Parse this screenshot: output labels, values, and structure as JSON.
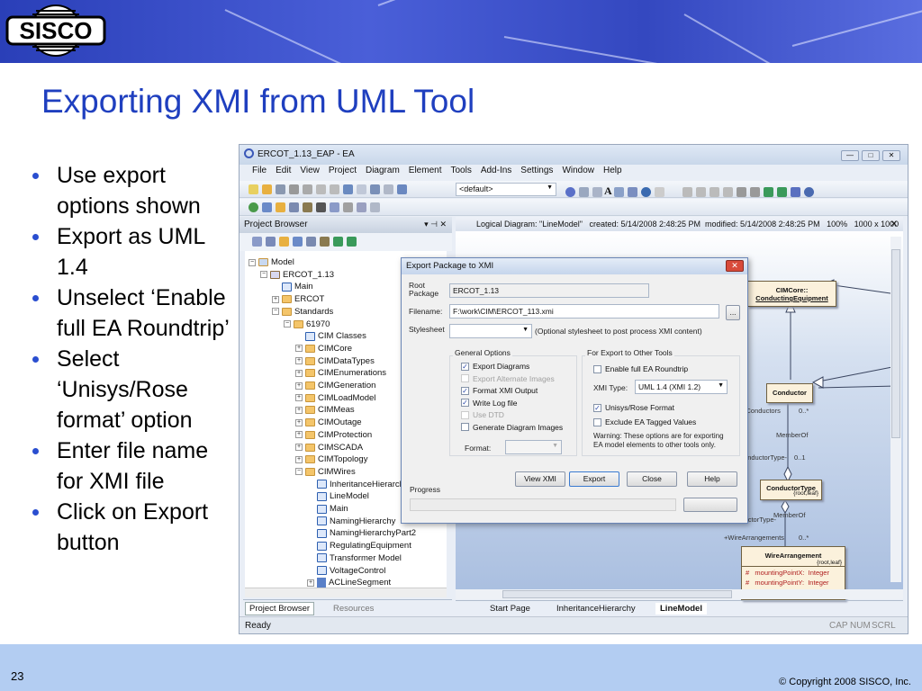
{
  "slide": {
    "title": "Exporting XMI from UML Tool",
    "page_number": "23",
    "copyright": "© Copyright 2008 SISCO, Inc.",
    "logo_text": "SISCO",
    "bullets": [
      "Use export options shown",
      "Export as UML 1.4",
      "Unselect ‘Enable full EA Roundtrip’",
      "Select ‘Unisys/Rose format’ option",
      "Enter file name for XMI file",
      "Click on Export button"
    ]
  },
  "app": {
    "title": "ERCOT_1.13_EAP - EA",
    "menu": [
      "File",
      "Edit",
      "View",
      "Project",
      "Diagram",
      "Element",
      "Tools",
      "Add-Ins",
      "Settings",
      "Window",
      "Help"
    ],
    "toolbar_combo": "<default>",
    "project_browser": {
      "title": "Project Browser",
      "tree": [
        {
          "label": "Model",
          "level": 0,
          "icon": "model",
          "exp": "-"
        },
        {
          "label": "ERCOT_1.13",
          "level": 1,
          "icon": "package",
          "exp": "-"
        },
        {
          "label": "Main",
          "level": 2,
          "icon": "diagram",
          "exp": ""
        },
        {
          "label": "ERCOT",
          "level": 2,
          "icon": "folder",
          "exp": "+"
        },
        {
          "label": "Standards",
          "level": 2,
          "icon": "folder",
          "exp": "-"
        },
        {
          "label": "61970",
          "level": 3,
          "icon": "folder",
          "exp": "-"
        },
        {
          "label": "CIM Classes",
          "level": 4,
          "icon": "diagram",
          "exp": ""
        },
        {
          "label": "CIMCore",
          "level": 4,
          "icon": "folder",
          "exp": "+"
        },
        {
          "label": "CIMDataTypes",
          "level": 4,
          "icon": "folder",
          "exp": "+"
        },
        {
          "label": "CIMEnumerations",
          "level": 4,
          "icon": "folder",
          "exp": "+"
        },
        {
          "label": "CIMGeneration",
          "level": 4,
          "icon": "folder",
          "exp": "+"
        },
        {
          "label": "CIMLoadModel",
          "level": 4,
          "icon": "folder",
          "exp": "+"
        },
        {
          "label": "CIMMeas",
          "level": 4,
          "icon": "folder",
          "exp": "+"
        },
        {
          "label": "CIMOutage",
          "level": 4,
          "icon": "folder",
          "exp": "+"
        },
        {
          "label": "CIMProtection",
          "level": 4,
          "icon": "folder",
          "exp": "+"
        },
        {
          "label": "CIMSCADA",
          "level": 4,
          "icon": "folder",
          "exp": "+"
        },
        {
          "label": "CIMTopology",
          "level": 4,
          "icon": "folder",
          "exp": "+"
        },
        {
          "label": "CIMWires",
          "level": 4,
          "icon": "folder",
          "exp": "-"
        },
        {
          "label": "InheritanceHierarchy",
          "level": 5,
          "icon": "diagram",
          "exp": ""
        },
        {
          "label": "LineModel",
          "level": 5,
          "icon": "diagram",
          "exp": ""
        },
        {
          "label": "Main",
          "level": 5,
          "icon": "diagram",
          "exp": ""
        },
        {
          "label": "NamingHierarchy",
          "level": 5,
          "icon": "diagram",
          "exp": ""
        },
        {
          "label": "NamingHierarchyPart2",
          "level": 5,
          "icon": "diagram",
          "exp": ""
        },
        {
          "label": "RegulatingEquipment",
          "level": 5,
          "icon": "diagram",
          "exp": ""
        },
        {
          "label": "Transformer Model",
          "level": 5,
          "icon": "diagram",
          "exp": ""
        },
        {
          "label": "VoltageControl",
          "level": 5,
          "icon": "diagram",
          "exp": ""
        },
        {
          "label": "ACLineSegment",
          "level": 5,
          "icon": "class",
          "exp": "+"
        }
      ],
      "tabs": [
        "Project Browser",
        "Resources"
      ]
    },
    "diagram_header": "Logical Diagram: \"LineModel\"   created: 5/14/2008 2:48:25 PM  modified: 5/14/2008 2:48:25 PM   100%   1000 x 1000",
    "diagram": {
      "cimcore": "CIMCore::",
      "cimcore2": "ConductingEquipment",
      "conductor": "Conductor",
      "conductors_role": "-Conductors",
      "mult1": "0..*",
      "memberof1": "MemberOf",
      "conductortype_role": "-ConductorType",
      "mult2": "0..1",
      "conductortype": "ConductorType",
      "conductortype_stereo": "{root,leaf}",
      "role3": "-ConductorType",
      "memberof2": "MemberOf",
      "wire_role": "+WireArrangements",
      "mult3": "0..*",
      "wire": "WireArrangement",
      "wire_stereo": "{root,leaf}",
      "attr1": "#   mountingPointX:  Integer",
      "attr2": "#   mountingPointY:  Integer"
    },
    "doc_tabs": [
      "Start Page",
      "InheritanceHierarchy",
      "LineModel"
    ],
    "status": {
      "text": "Ready",
      "cap": "CAP",
      "num": "NUM",
      "scrl": "SCRL"
    },
    "dialog": {
      "title": "Export Package to XMI",
      "root_label": "Root Package",
      "root_value": "ERCOT_1.13",
      "filename_label": "Filename:",
      "filename_value": "F:\\work\\CIM\\ERCOT_113.xmi",
      "browse": "...",
      "stylesheet_label": "Stylesheet",
      "stylesheet_hint": "(Optional stylesheet to post process XMI content)",
      "general_title": "General Options",
      "general": [
        {
          "label": "Export Diagrams",
          "checked": true,
          "enabled": true
        },
        {
          "label": "Export Alternate Images",
          "checked": false,
          "enabled": false
        },
        {
          "label": "Format XMI Output",
          "checked": true,
          "enabled": true
        },
        {
          "label": "Write Log file",
          "checked": true,
          "enabled": true
        },
        {
          "label": "Use DTD",
          "checked": false,
          "enabled": false
        },
        {
          "label": "Generate Diagram Images",
          "checked": false,
          "enabled": true
        }
      ],
      "format_label": "Format:",
      "other_title": "For Export to Other Tools",
      "roundtrip": {
        "label": "Enable full EA Roundtrip",
        "checked": false
      },
      "xmi_type_label": "XMI Type:",
      "xmi_type": "UML 1.4 (XMI 1.2)",
      "unisys": {
        "label": "Unisys/Rose Format",
        "checked": true
      },
      "exclude": {
        "label": "Exclude EA Tagged Values",
        "checked": false
      },
      "warning": "Warning: These options are for exporting EA model elements to other tools only.",
      "buttons": {
        "view": "View XMI",
        "export": "Export",
        "close": "Close",
        "help": "Help"
      },
      "progress_label": "Progress",
      "progress": 0
    }
  }
}
